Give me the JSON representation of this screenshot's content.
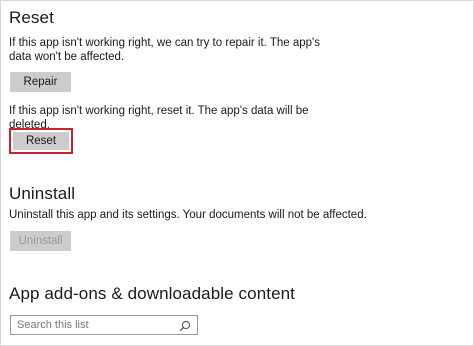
{
  "reset_section": {
    "title": "Reset",
    "repair_description": "If this app isn't working right, we can try to repair it. The app's data won't be affected.",
    "repair_button": "Repair",
    "reset_description": "If this app isn't working right, reset it. The app's data will be deleted.",
    "reset_button": "Reset"
  },
  "uninstall_section": {
    "title": "Uninstall",
    "description": "Uninstall this app and its settings. Your documents will not be affected.",
    "uninstall_button": "Uninstall"
  },
  "addons_section": {
    "title": "App add-ons & downloadable content",
    "search_placeholder": "Search this list",
    "search_icon": "search-icon"
  },
  "colors": {
    "highlight": "#d0202a",
    "button_bg": "#cccccc"
  }
}
